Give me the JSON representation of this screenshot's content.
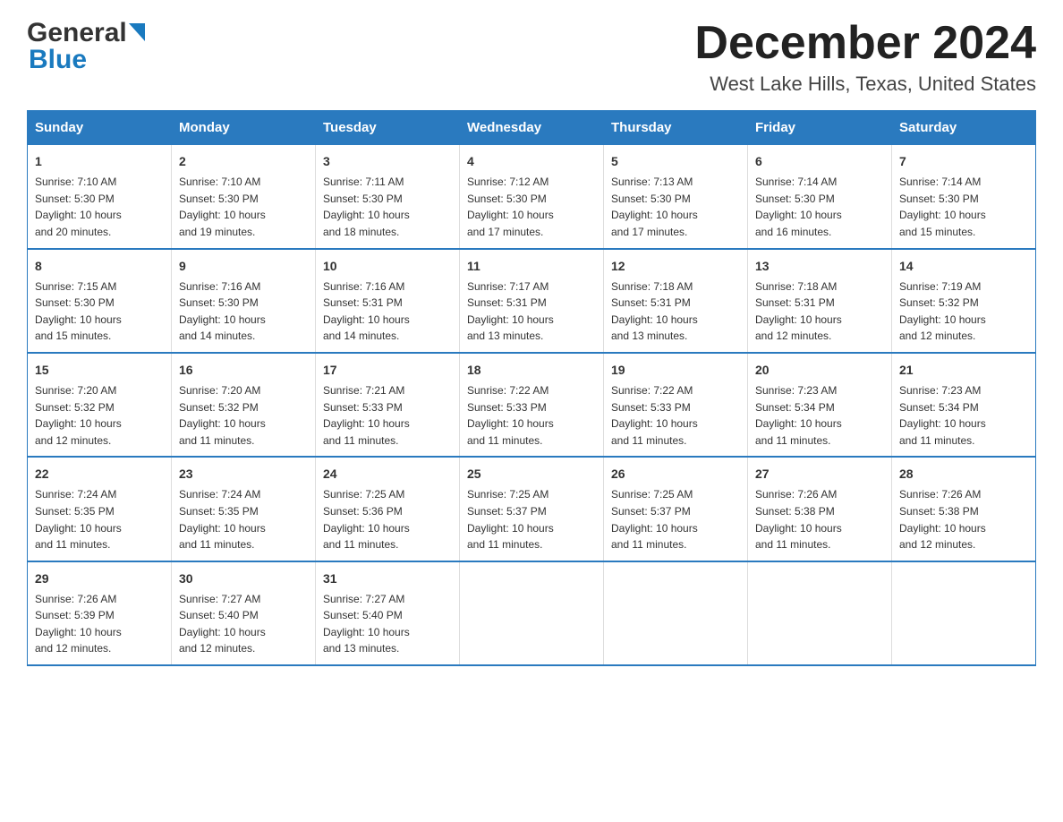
{
  "header": {
    "logo": {
      "general": "General",
      "triangle": "▶",
      "blue": "Blue"
    },
    "title": "December 2024",
    "location": "West Lake Hills, Texas, United States"
  },
  "days_of_week": [
    "Sunday",
    "Monday",
    "Tuesday",
    "Wednesday",
    "Thursday",
    "Friday",
    "Saturday"
  ],
  "weeks": [
    [
      {
        "day": "1",
        "sunrise": "7:10 AM",
        "sunset": "5:30 PM",
        "daylight": "10 hours and 20 minutes."
      },
      {
        "day": "2",
        "sunrise": "7:10 AM",
        "sunset": "5:30 PM",
        "daylight": "10 hours and 19 minutes."
      },
      {
        "day": "3",
        "sunrise": "7:11 AM",
        "sunset": "5:30 PM",
        "daylight": "10 hours and 18 minutes."
      },
      {
        "day": "4",
        "sunrise": "7:12 AM",
        "sunset": "5:30 PM",
        "daylight": "10 hours and 17 minutes."
      },
      {
        "day": "5",
        "sunrise": "7:13 AM",
        "sunset": "5:30 PM",
        "daylight": "10 hours and 17 minutes."
      },
      {
        "day": "6",
        "sunrise": "7:14 AM",
        "sunset": "5:30 PM",
        "daylight": "10 hours and 16 minutes."
      },
      {
        "day": "7",
        "sunrise": "7:14 AM",
        "sunset": "5:30 PM",
        "daylight": "10 hours and 15 minutes."
      }
    ],
    [
      {
        "day": "8",
        "sunrise": "7:15 AM",
        "sunset": "5:30 PM",
        "daylight": "10 hours and 15 minutes."
      },
      {
        "day": "9",
        "sunrise": "7:16 AM",
        "sunset": "5:30 PM",
        "daylight": "10 hours and 14 minutes."
      },
      {
        "day": "10",
        "sunrise": "7:16 AM",
        "sunset": "5:31 PM",
        "daylight": "10 hours and 14 minutes."
      },
      {
        "day": "11",
        "sunrise": "7:17 AM",
        "sunset": "5:31 PM",
        "daylight": "10 hours and 13 minutes."
      },
      {
        "day": "12",
        "sunrise": "7:18 AM",
        "sunset": "5:31 PM",
        "daylight": "10 hours and 13 minutes."
      },
      {
        "day": "13",
        "sunrise": "7:18 AM",
        "sunset": "5:31 PM",
        "daylight": "10 hours and 12 minutes."
      },
      {
        "day": "14",
        "sunrise": "7:19 AM",
        "sunset": "5:32 PM",
        "daylight": "10 hours and 12 minutes."
      }
    ],
    [
      {
        "day": "15",
        "sunrise": "7:20 AM",
        "sunset": "5:32 PM",
        "daylight": "10 hours and 12 minutes."
      },
      {
        "day": "16",
        "sunrise": "7:20 AM",
        "sunset": "5:32 PM",
        "daylight": "10 hours and 11 minutes."
      },
      {
        "day": "17",
        "sunrise": "7:21 AM",
        "sunset": "5:33 PM",
        "daylight": "10 hours and 11 minutes."
      },
      {
        "day": "18",
        "sunrise": "7:22 AM",
        "sunset": "5:33 PM",
        "daylight": "10 hours and 11 minutes."
      },
      {
        "day": "19",
        "sunrise": "7:22 AM",
        "sunset": "5:33 PM",
        "daylight": "10 hours and 11 minutes."
      },
      {
        "day": "20",
        "sunrise": "7:23 AM",
        "sunset": "5:34 PM",
        "daylight": "10 hours and 11 minutes."
      },
      {
        "day": "21",
        "sunrise": "7:23 AM",
        "sunset": "5:34 PM",
        "daylight": "10 hours and 11 minutes."
      }
    ],
    [
      {
        "day": "22",
        "sunrise": "7:24 AM",
        "sunset": "5:35 PM",
        "daylight": "10 hours and 11 minutes."
      },
      {
        "day": "23",
        "sunrise": "7:24 AM",
        "sunset": "5:35 PM",
        "daylight": "10 hours and 11 minutes."
      },
      {
        "day": "24",
        "sunrise": "7:25 AM",
        "sunset": "5:36 PM",
        "daylight": "10 hours and 11 minutes."
      },
      {
        "day": "25",
        "sunrise": "7:25 AM",
        "sunset": "5:37 PM",
        "daylight": "10 hours and 11 minutes."
      },
      {
        "day": "26",
        "sunrise": "7:25 AM",
        "sunset": "5:37 PM",
        "daylight": "10 hours and 11 minutes."
      },
      {
        "day": "27",
        "sunrise": "7:26 AM",
        "sunset": "5:38 PM",
        "daylight": "10 hours and 11 minutes."
      },
      {
        "day": "28",
        "sunrise": "7:26 AM",
        "sunset": "5:38 PM",
        "daylight": "10 hours and 12 minutes."
      }
    ],
    [
      {
        "day": "29",
        "sunrise": "7:26 AM",
        "sunset": "5:39 PM",
        "daylight": "10 hours and 12 minutes."
      },
      {
        "day": "30",
        "sunrise": "7:27 AM",
        "sunset": "5:40 PM",
        "daylight": "10 hours and 12 minutes."
      },
      {
        "day": "31",
        "sunrise": "7:27 AM",
        "sunset": "5:40 PM",
        "daylight": "10 hours and 13 minutes."
      },
      null,
      null,
      null,
      null
    ]
  ]
}
